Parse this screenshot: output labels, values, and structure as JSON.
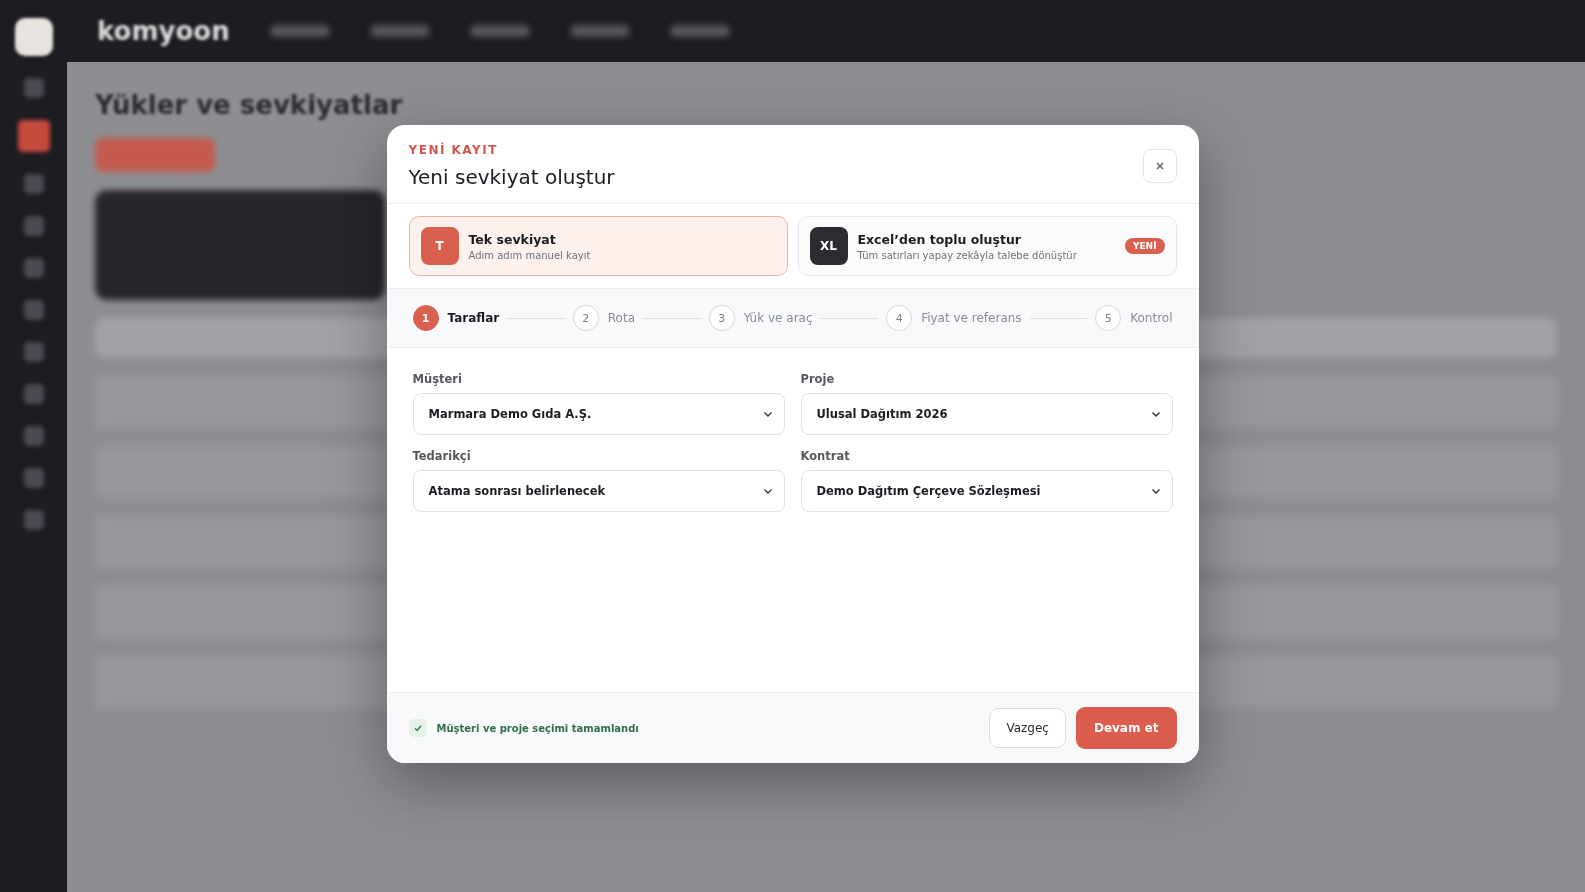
{
  "background_page": {
    "logo": "komyoon",
    "title": "Yükler ve sevkiyatlar"
  },
  "dialog": {
    "eyebrow": "YENİ KAYIT",
    "title": "Yeni sevkiyat oluştur",
    "modes": [
      {
        "icon_text": "T",
        "title": "Tek sevkiyat",
        "subtitle": "Adım adım manuel kayıt",
        "selected": true
      },
      {
        "icon_text": "XL",
        "title": "Excel’den toplu oluştur",
        "subtitle": "Tüm satırları yapay zekâyla talebe dönüştür",
        "badge": "YENİ",
        "selected": false
      }
    ],
    "steps": [
      {
        "number": "1",
        "label": "Taraflar",
        "selected": true
      },
      {
        "number": "2",
        "label": "Rota",
        "selected": false
      },
      {
        "number": "3",
        "label": "Yük ve araç",
        "selected": false
      },
      {
        "number": "4",
        "label": "Fiyat ve referans",
        "selected": false
      },
      {
        "number": "5",
        "label": "Kontrol",
        "selected": false
      }
    ],
    "fields": [
      {
        "label": "Müşteri",
        "value": "Marmara Demo Gıda A.Ş."
      },
      {
        "label": "Proje",
        "value": "Ulusal Dağıtım 2026"
      },
      {
        "label": "Tedarikçi",
        "value": "Atama sonrası belirlenecek"
      },
      {
        "label": "Kontrat",
        "value": "Demo Dağıtım Çerçeve Sözleşmesi"
      }
    ],
    "status": {
      "text": "Müşteri ve proje seçimi tamamlandı",
      "checked": true
    },
    "buttons": [
      {
        "label": "Vazgeç",
        "kind": "secondary"
      },
      {
        "label": "Devam et",
        "kind": "primary"
      }
    ]
  }
}
